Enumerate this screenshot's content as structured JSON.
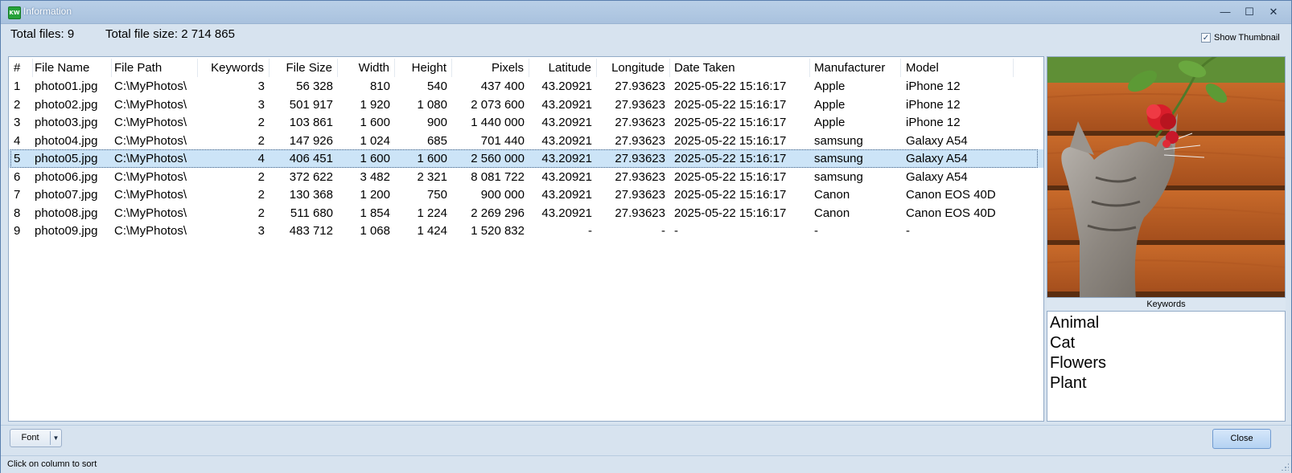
{
  "window": {
    "title": "Information",
    "app_icon_text": "KW",
    "controls": {
      "minimize": "—",
      "maximize": "☐",
      "close": "✕"
    }
  },
  "summary": {
    "total_files": "Total files: 9",
    "total_size": "Total file size: 2 714 865"
  },
  "show_thumbnail": {
    "label": "Show Thumbnail",
    "checked": true
  },
  "table": {
    "columns": [
      "#",
      "File Name",
      "File Path",
      "Keywords",
      "File Size",
      "Width",
      "Height",
      "Pixels",
      "Latitude",
      "Longitude",
      "Date Taken",
      "Manufacturer",
      "Model"
    ],
    "selected_index": 4,
    "rows": [
      [
        "1",
        "photo01.jpg",
        "C:\\MyPhotos\\",
        "3",
        "56 328",
        "810",
        "540",
        "437 400",
        "43.20921",
        "27.93623",
        "2025-05-22 15:16:17",
        "Apple",
        "iPhone 12"
      ],
      [
        "2",
        "photo02.jpg",
        "C:\\MyPhotos\\",
        "3",
        "501 917",
        "1 920",
        "1 080",
        "2 073 600",
        "43.20921",
        "27.93623",
        "2025-05-22 15:16:17",
        "Apple",
        "iPhone 12"
      ],
      [
        "3",
        "photo03.jpg",
        "C:\\MyPhotos\\",
        "2",
        "103 861",
        "1 600",
        "900",
        "1 440 000",
        "43.20921",
        "27.93623",
        "2025-05-22 15:16:17",
        "Apple",
        "iPhone 12"
      ],
      [
        "4",
        "photo04.jpg",
        "C:\\MyPhotos\\",
        "2",
        "147 926",
        "1 024",
        "685",
        "701 440",
        "43.20921",
        "27.93623",
        "2025-05-22 15:16:17",
        "samsung",
        "Galaxy A54"
      ],
      [
        "5",
        "photo05.jpg",
        "C:\\MyPhotos\\",
        "4",
        "406 451",
        "1 600",
        "1 600",
        "2 560 000",
        "43.20921",
        "27.93623",
        "2025-05-22 15:16:17",
        "samsung",
        "Galaxy A54"
      ],
      [
        "6",
        "photo06.jpg",
        "C:\\MyPhotos\\",
        "2",
        "372 622",
        "3 482",
        "2 321",
        "8 081 722",
        "43.20921",
        "27.93623",
        "2025-05-22 15:16:17",
        "samsung",
        "Galaxy A54"
      ],
      [
        "7",
        "photo07.jpg",
        "C:\\MyPhotos\\",
        "2",
        "130 368",
        "1 200",
        "750",
        "900 000",
        "43.20921",
        "27.93623",
        "2025-05-22 15:16:17",
        "Canon",
        "Canon EOS 40D"
      ],
      [
        "8",
        "photo08.jpg",
        "C:\\MyPhotos\\",
        "2",
        "511 680",
        "1 854",
        "1 224",
        "2 269 296",
        "43.20921",
        "27.93623",
        "2025-05-22 15:16:17",
        "Canon",
        "Canon EOS 40D"
      ],
      [
        "9",
        "photo09.jpg",
        "C:\\MyPhotos\\",
        "3",
        "483 712",
        "1 068",
        "1 424",
        "1 520 832",
        "-",
        "-",
        "-",
        "-",
        "-"
      ]
    ]
  },
  "keywords_panel": {
    "header": "Keywords",
    "items": [
      "Animal",
      "Cat",
      "Flowers",
      "Plant"
    ]
  },
  "buttons": {
    "font": "Font",
    "close": "Close"
  },
  "status": "Click on column to sort",
  "colors": {
    "accent": "#cce4f7",
    "window_bg": "#d7e3ef",
    "titlebar": "#b1c9e3"
  }
}
